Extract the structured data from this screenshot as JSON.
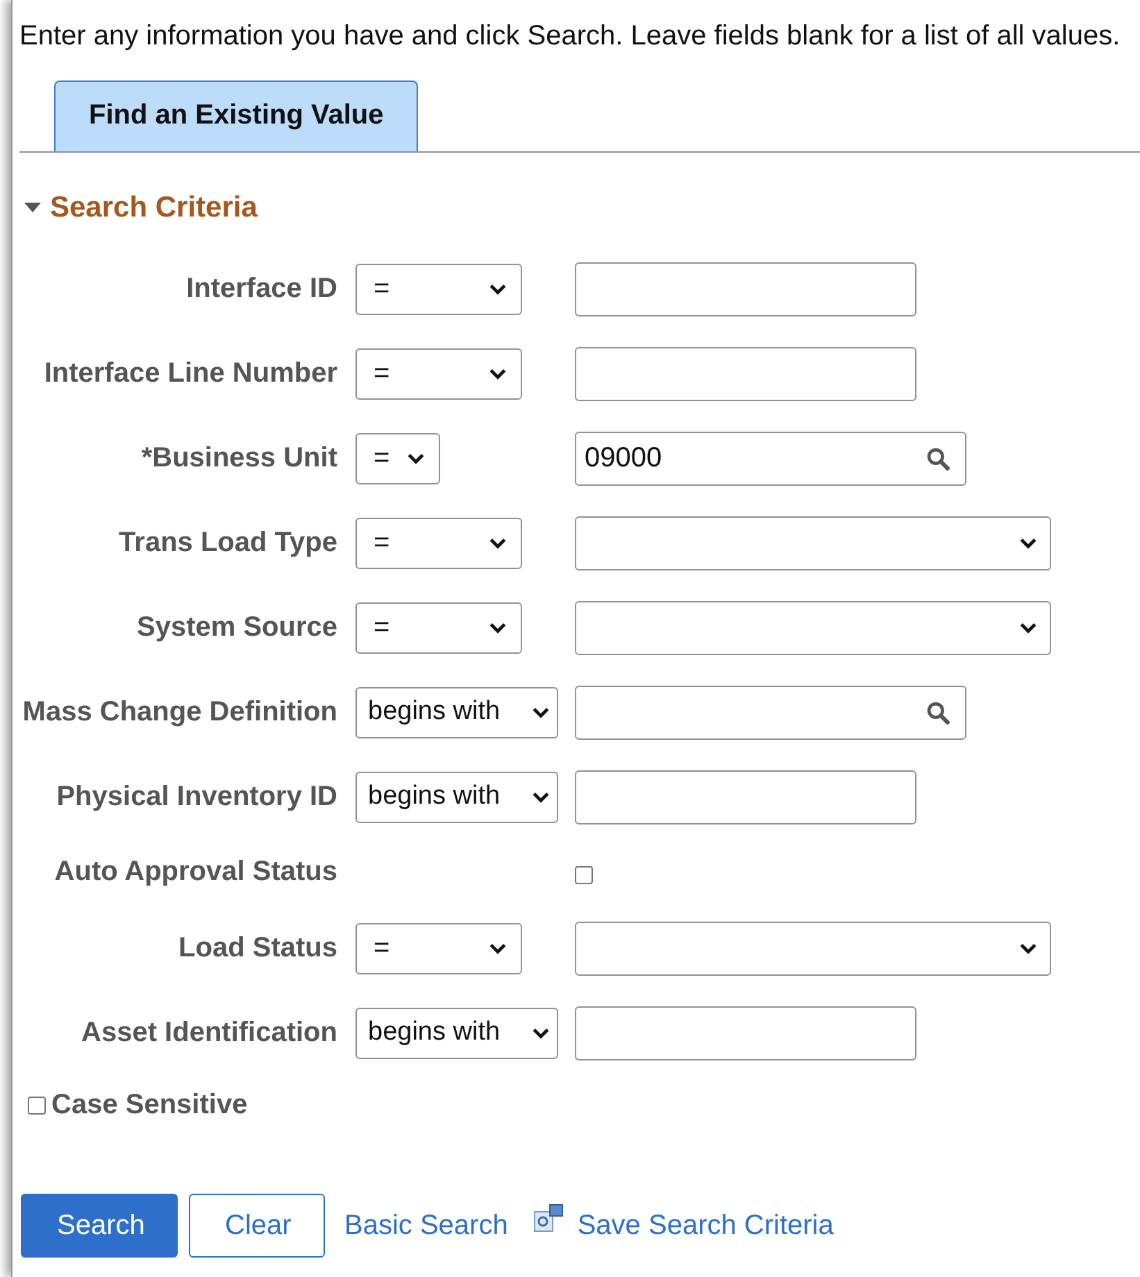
{
  "instructions": "Enter any information you have and click Search. Leave fields blank for a list of all values.",
  "tabs": [
    {
      "label": "Find an Existing Value",
      "selected": true
    }
  ],
  "section": {
    "title": "Search Criteria",
    "expanded": true
  },
  "fields": [
    {
      "label": "Interface ID",
      "kind": "text",
      "operator": "="
    },
    {
      "label": "Interface Line Number",
      "kind": "text",
      "operator": "="
    },
    {
      "label": "*Business Unit",
      "kind": "lookup",
      "operator": "=",
      "value": "09000"
    },
    {
      "label": "Trans Load Type",
      "kind": "dropdown",
      "operator": "="
    },
    {
      "label": "System Source",
      "kind": "dropdown",
      "operator": "="
    },
    {
      "label": "Mass Change Definition",
      "kind": "lookup",
      "operator": "begins with"
    },
    {
      "label": "Physical Inventory ID",
      "kind": "text",
      "operator": "begins with"
    },
    {
      "label": "Auto Approval Status",
      "kind": "checkbox",
      "checked": false
    },
    {
      "label": "Load Status",
      "kind": "dropdown",
      "operator": "="
    },
    {
      "label": "Asset Identification",
      "kind": "text",
      "operator": "begins with"
    }
  ],
  "case_sensitive": {
    "label": "Case Sensitive",
    "checked": false
  },
  "buttons": [
    {
      "label": "Search",
      "kind": "primary"
    },
    {
      "label": "Clear",
      "kind": "secondary"
    }
  ],
  "links": [
    {
      "label": "Basic Search",
      "kind": "plain"
    },
    {
      "label": "Save Search Criteria",
      "kind": "icon"
    }
  ]
}
